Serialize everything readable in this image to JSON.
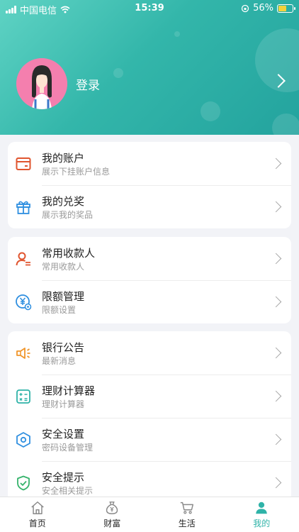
{
  "status_bar": {
    "carrier": "中国电信",
    "time": "15:39",
    "battery": "56%",
    "battery_level": 0.56
  },
  "header": {
    "login_label": "登录"
  },
  "colors": {
    "accent": "#2fb3a8",
    "header_start": "#5fd3c4",
    "header_end": "#23a39e",
    "icon_red": "#e0552f",
    "icon_blue": "#2f8fe0",
    "icon_orange": "#f0962b",
    "icon_green": "#35b36b"
  },
  "groups": [
    {
      "items": [
        {
          "title": "我的账户",
          "subtitle": "展示下挂账户信息",
          "icon": "wallet-icon"
        },
        {
          "title": "我的兑奖",
          "subtitle": "展示我的奖品",
          "icon": "gift-icon"
        }
      ]
    },
    {
      "items": [
        {
          "title": "常用收款人",
          "subtitle": "常用收款人",
          "icon": "payee-icon"
        },
        {
          "title": "限额管理",
          "subtitle": "限额设置",
          "icon": "limit-icon"
        }
      ]
    },
    {
      "items": [
        {
          "title": "银行公告",
          "subtitle": "最新消息",
          "icon": "megaphone-icon"
        },
        {
          "title": "理财计算器",
          "subtitle": "理财计算器",
          "icon": "calculator-icon"
        },
        {
          "title": "安全设置",
          "subtitle": "密码设备管理",
          "icon": "hexagon-settings-icon"
        },
        {
          "title": "安全提示",
          "subtitle": "安全相关提示",
          "icon": "shield-check-icon"
        }
      ]
    }
  ],
  "tabs": [
    {
      "label": "首页",
      "icon": "home-icon",
      "active": false
    },
    {
      "label": "财富",
      "icon": "money-bag-icon",
      "active": false
    },
    {
      "label": "生活",
      "icon": "cart-icon",
      "active": false
    },
    {
      "label": "我的",
      "icon": "person-icon",
      "active": true
    }
  ]
}
